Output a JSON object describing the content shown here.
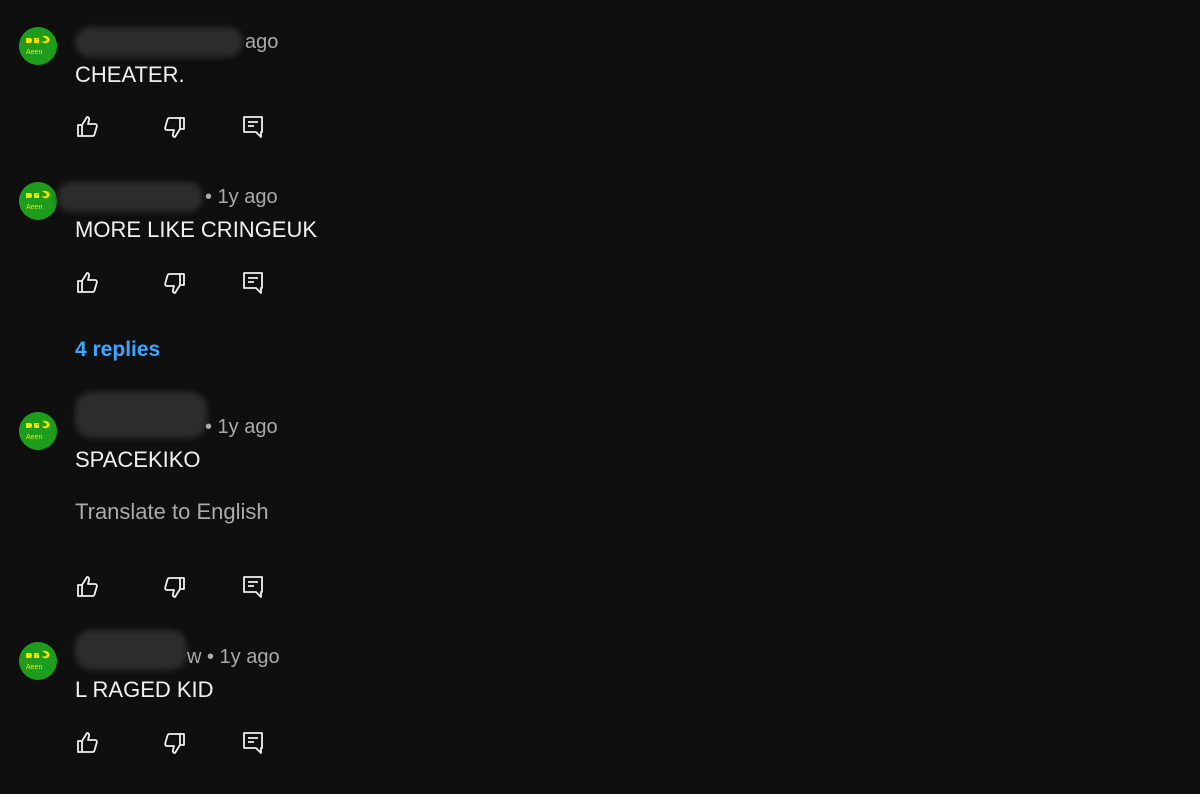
{
  "colors": {
    "background": "#0f0f0f",
    "text_primary": "#f1f1f1",
    "text_secondary": "#aaaaaa",
    "link_blue": "#3ea6ff",
    "avatar_green": "#1e9c1c",
    "avatar_yellow": "#f5e400"
  },
  "comments": [
    {
      "meta_visible": "ago",
      "text": "CHEATER."
    },
    {
      "meta_visible": "• 1y ago",
      "text": "MORE LIKE CRINGEUK",
      "replies_label": "4 replies"
    },
    {
      "meta_visible": "• 1y ago",
      "text": "SPACEKIKO",
      "translate_label": "Translate to English"
    },
    {
      "meta_visible": "w • 1y ago",
      "text": "L RAGED KID"
    }
  ],
  "icons": {
    "like": "thumbs-up-icon",
    "dislike": "thumbs-down-icon",
    "reply": "reply-icon"
  }
}
